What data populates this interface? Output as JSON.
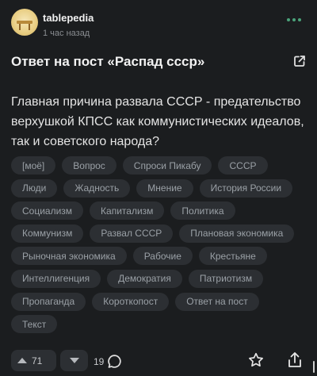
{
  "post": {
    "author": "tablepedia",
    "time": "1 час назад",
    "title": "Ответ на пост «Распад ссср»",
    "body": "Главная причина развала СССР - предательство верхушкой КПСС как коммунистических идеалов, так и советского народа?"
  },
  "tags": [
    [
      "[моё]",
      "Вопрос",
      "Спроси Пикабу",
      "СССР"
    ],
    [
      "Люди",
      "Жадность",
      "Мнение",
      "История России"
    ],
    [
      "Социализм",
      "Капитализм",
      "Политика"
    ],
    [
      "Коммунизм",
      "Развал СССР",
      "Плановая экономика"
    ],
    [
      "Рыночная экономика",
      "Рабочие",
      "Крестьяне"
    ],
    [
      "Интеллигенция",
      "Демократия",
      "Патриотизм"
    ],
    [
      "Пропаганда",
      "Короткопост",
      "Ответ на пост"
    ],
    [
      "Текст"
    ]
  ],
  "footer": {
    "rating": "71",
    "comments": "19"
  },
  "colors": {
    "background": "#1b1d1f",
    "tag_background": "#2c2f33",
    "accent_green": "#4ba37a"
  },
  "icons": [
    "more-icon",
    "external-link-icon",
    "upvote-icon",
    "downvote-icon",
    "comment-icon",
    "star-icon",
    "share-icon"
  ]
}
